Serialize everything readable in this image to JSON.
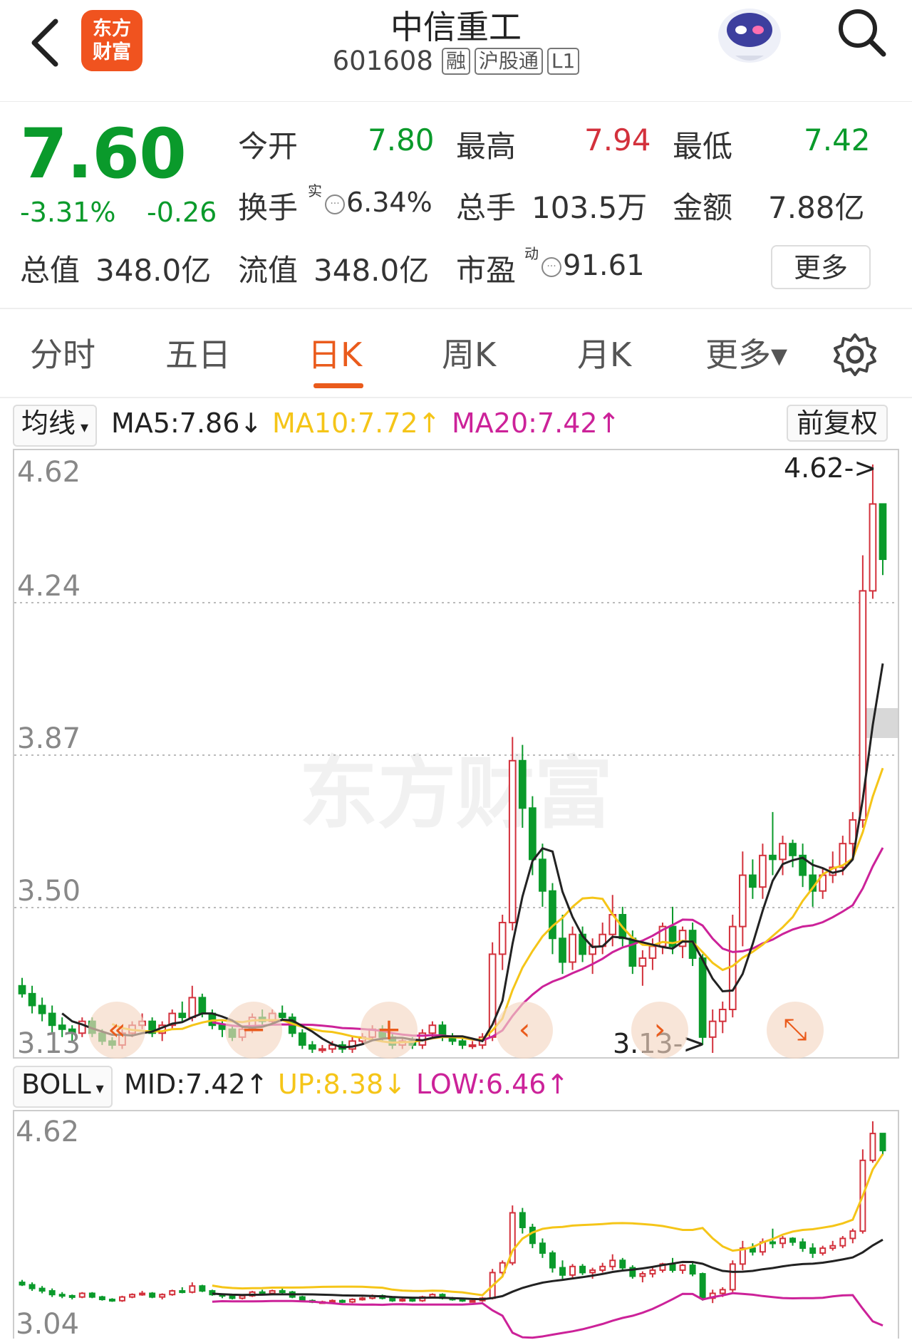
{
  "header": {
    "back_icon": "chevron-left-icon",
    "logo_line1": "东方",
    "logo_line2": "财富",
    "stock_name": "中信重工",
    "stock_code": "601608",
    "tags": [
      "融",
      "沪股通",
      "L1"
    ],
    "assistant_icon": "robot-avatar-icon",
    "search_icon": "search-icon"
  },
  "quote": {
    "price": "7.60",
    "change_pct": "-3.31%",
    "change": "-0.26",
    "open_label": "今开",
    "open": "7.80",
    "high_label": "最高",
    "high": "7.94",
    "low_label": "最低",
    "low": "7.42",
    "turnover_label": "换手",
    "turnover_sup": "实",
    "turnover": "6.34%",
    "volume_label": "总手",
    "volume": "103.5万",
    "amount_label": "金额",
    "amount": "7.88亿",
    "mktcap_label": "总值",
    "mktcap": "348.0亿",
    "float_label": "流值",
    "float_cap": "348.0亿",
    "pe_label": "市盈",
    "pe_sup": "动",
    "pe": "91.61",
    "more_label": "更多",
    "colors": {
      "up": "#d3313c",
      "down": "#0a9a2b"
    }
  },
  "tabs": {
    "items": [
      "分时",
      "五日",
      "日K",
      "周K",
      "月K",
      "更多▾"
    ],
    "active": "日K",
    "settings_icon": "gear-icon"
  },
  "ma_row": {
    "selector": "均线",
    "ma5": "MA5:7.86↓",
    "ma10": "MA10:7.72↑",
    "ma20": "MA20:7.42↑",
    "adjust": "前复权",
    "colors": {
      "ma5": "#222222",
      "ma10": "#f5c518",
      "ma20": "#cc2299"
    }
  },
  "kline": {
    "y_labels": [
      "4.62",
      "4.24",
      "3.87",
      "3.50",
      "3.13"
    ],
    "max_annotation": "4.62->",
    "min_annotation": "3.13->",
    "watermark": "东方财富",
    "controls": [
      "«",
      "−",
      "+",
      "‹",
      "›",
      "⤡"
    ],
    "control_icons": [
      "rewind-icon",
      "zoom-out-icon",
      "zoom-in-icon",
      "prev-icon",
      "next-icon",
      "expand-icon"
    ]
  },
  "boll_row": {
    "selector": "BOLL",
    "mid": "MID:7.42↑",
    "up": "UP:8.38↓",
    "low": "LOW:6.46↑",
    "colors": {
      "mid": "#222222",
      "up": "#f5c518",
      "low": "#cc2299"
    }
  },
  "boll_chart": {
    "y_labels": [
      "4.62",
      "3.04"
    ]
  },
  "chart_data": {
    "type": "candlestick",
    "ylim": [
      3.13,
      4.62
    ],
    "ohlc": [
      [
        3.3,
        3.32,
        3.27,
        3.28
      ],
      [
        3.28,
        3.3,
        3.23,
        3.25
      ],
      [
        3.25,
        3.27,
        3.21,
        3.23
      ],
      [
        3.23,
        3.25,
        3.18,
        3.2
      ],
      [
        3.2,
        3.22,
        3.17,
        3.19
      ],
      [
        3.19,
        3.2,
        3.16,
        3.18
      ],
      [
        3.18,
        3.22,
        3.17,
        3.21
      ],
      [
        3.21,
        3.22,
        3.17,
        3.18
      ],
      [
        3.18,
        3.19,
        3.15,
        3.16
      ],
      [
        3.16,
        3.17,
        3.14,
        3.15
      ],
      [
        3.15,
        3.19,
        3.14,
        3.18
      ],
      [
        3.18,
        3.21,
        3.17,
        3.2
      ],
      [
        3.2,
        3.23,
        3.19,
        3.21
      ],
      [
        3.21,
        3.22,
        3.17,
        3.18
      ],
      [
        3.18,
        3.21,
        3.16,
        3.2
      ],
      [
        3.2,
        3.24,
        3.19,
        3.23
      ],
      [
        3.23,
        3.26,
        3.21,
        3.22
      ],
      [
        3.22,
        3.3,
        3.21,
        3.27
      ],
      [
        3.27,
        3.28,
        3.22,
        3.23
      ],
      [
        3.23,
        3.24,
        3.19,
        3.2
      ],
      [
        3.2,
        3.21,
        3.17,
        3.19
      ],
      [
        3.19,
        3.2,
        3.16,
        3.17
      ],
      [
        3.17,
        3.2,
        3.16,
        3.19
      ],
      [
        3.19,
        3.23,
        3.18,
        3.22
      ],
      [
        3.22,
        3.24,
        3.2,
        3.21
      ],
      [
        3.21,
        3.24,
        3.2,
        3.23
      ],
      [
        3.23,
        3.25,
        3.21,
        3.22
      ],
      [
        3.22,
        3.23,
        3.17,
        3.18
      ],
      [
        3.18,
        3.19,
        3.14,
        3.15
      ],
      [
        3.15,
        3.16,
        3.13,
        3.14
      ],
      [
        3.14,
        3.15,
        3.13,
        3.14
      ],
      [
        3.14,
        3.16,
        3.13,
        3.15
      ],
      [
        3.15,
        3.16,
        3.13,
        3.14
      ],
      [
        3.14,
        3.17,
        3.13,
        3.16
      ],
      [
        3.16,
        3.18,
        3.15,
        3.17
      ],
      [
        3.17,
        3.2,
        3.16,
        3.19
      ],
      [
        3.19,
        3.2,
        3.16,
        3.17
      ],
      [
        3.17,
        3.18,
        3.14,
        3.15
      ],
      [
        3.15,
        3.17,
        3.14,
        3.16
      ],
      [
        3.16,
        3.17,
        3.14,
        3.15
      ],
      [
        3.15,
        3.19,
        3.14,
        3.18
      ],
      [
        3.18,
        3.21,
        3.17,
        3.2
      ],
      [
        3.2,
        3.21,
        3.16,
        3.17
      ],
      [
        3.17,
        3.18,
        3.15,
        3.16
      ],
      [
        3.16,
        3.17,
        3.14,
        3.15
      ],
      [
        3.15,
        3.16,
        3.14,
        3.15
      ],
      [
        3.15,
        3.18,
        3.14,
        3.17
      ],
      [
        3.17,
        3.41,
        3.16,
        3.38
      ],
      [
        3.38,
        3.48,
        3.34,
        3.46
      ],
      [
        3.46,
        3.93,
        3.44,
        3.87
      ],
      [
        3.87,
        3.91,
        3.7,
        3.75
      ],
      [
        3.75,
        3.78,
        3.58,
        3.62
      ],
      [
        3.62,
        3.66,
        3.5,
        3.54
      ],
      [
        3.54,
        3.56,
        3.38,
        3.42
      ],
      [
        3.42,
        3.48,
        3.33,
        3.36
      ],
      [
        3.36,
        3.45,
        3.34,
        3.43
      ],
      [
        3.43,
        3.45,
        3.36,
        3.38
      ],
      [
        3.38,
        3.42,
        3.33,
        3.4
      ],
      [
        3.4,
        3.46,
        3.38,
        3.43
      ],
      [
        3.43,
        3.53,
        3.4,
        3.48
      ],
      [
        3.48,
        3.5,
        3.4,
        3.42
      ],
      [
        3.42,
        3.44,
        3.33,
        3.35
      ],
      [
        3.35,
        3.39,
        3.3,
        3.37
      ],
      [
        3.37,
        3.42,
        3.34,
        3.4
      ],
      [
        3.4,
        3.46,
        3.38,
        3.45
      ],
      [
        3.45,
        3.5,
        3.38,
        3.4
      ],
      [
        3.4,
        3.45,
        3.37,
        3.44
      ],
      [
        3.44,
        3.46,
        3.35,
        3.37
      ],
      [
        3.37,
        3.38,
        3.15,
        3.17
      ],
      [
        3.17,
        3.24,
        3.13,
        3.21
      ],
      [
        3.21,
        3.26,
        3.18,
        3.24
      ],
      [
        3.24,
        3.48,
        3.22,
        3.45
      ],
      [
        3.45,
        3.64,
        3.4,
        3.58
      ],
      [
        3.58,
        3.62,
        3.52,
        3.55
      ],
      [
        3.55,
        3.66,
        3.52,
        3.63
      ],
      [
        3.63,
        3.74,
        3.58,
        3.62
      ],
      [
        3.62,
        3.68,
        3.58,
        3.66
      ],
      [
        3.66,
        3.67,
        3.6,
        3.63
      ],
      [
        3.63,
        3.66,
        3.55,
        3.58
      ],
      [
        3.58,
        3.62,
        3.5,
        3.54
      ],
      [
        3.54,
        3.6,
        3.52,
        3.58
      ],
      [
        3.58,
        3.64,
        3.56,
        3.6
      ],
      [
        3.6,
        3.68,
        3.58,
        3.66
      ],
      [
        3.66,
        3.74,
        3.62,
        3.72
      ],
      [
        3.72,
        4.39,
        3.7,
        4.3
      ],
      [
        4.3,
        4.62,
        4.28,
        4.52
      ],
      [
        4.52,
        4.48,
        4.34,
        4.38
      ]
    ],
    "ma5_color": "#222222",
    "ma10_color": "#f5c518",
    "ma20_color": "#cc2299"
  }
}
